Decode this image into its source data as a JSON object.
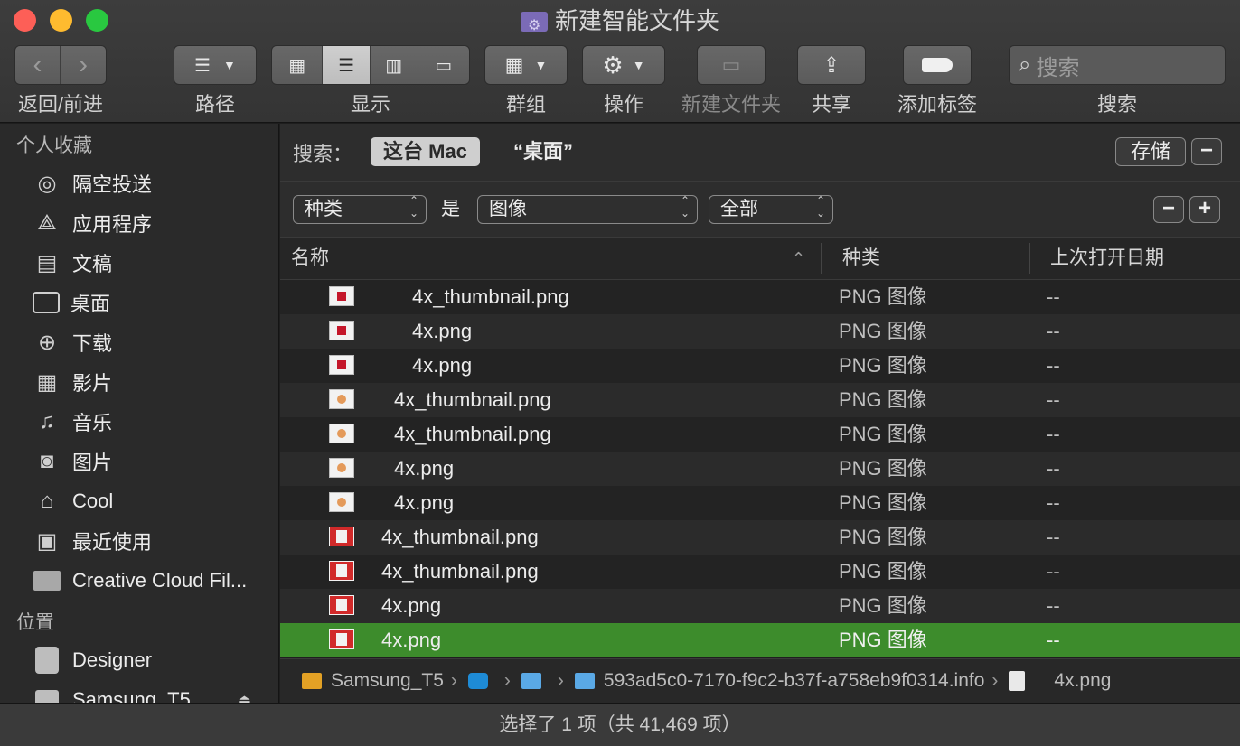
{
  "window": {
    "title": "新建智能文件夹"
  },
  "toolbar": {
    "nav_label": "返回/前进",
    "path_label": "路径",
    "view_label": "显示",
    "group_label": "群组",
    "action_label": "操作",
    "new_folder_label": "新建文件夹",
    "share_label": "共享",
    "tag_label": "添加标签",
    "search_label": "搜索",
    "search_placeholder": "搜索"
  },
  "sidebar": {
    "favorites_header": "个人收藏",
    "favorites": [
      {
        "label": "隔空投送",
        "icon": "airdrop-icon"
      },
      {
        "label": "应用程序",
        "icon": "applications-icon"
      },
      {
        "label": "文稿",
        "icon": "documents-icon"
      },
      {
        "label": "桌面",
        "icon": "desktop-icon"
      },
      {
        "label": "下载",
        "icon": "downloads-icon"
      },
      {
        "label": "影片",
        "icon": "movies-icon"
      },
      {
        "label": "音乐",
        "icon": "music-icon"
      },
      {
        "label": "图片",
        "icon": "pictures-icon"
      },
      {
        "label": "Cool",
        "icon": "home-icon"
      },
      {
        "label": "最近使用",
        "icon": "recents-icon"
      },
      {
        "label": "Creative Cloud Fil...",
        "icon": "folder-icon"
      }
    ],
    "locations_header": "位置",
    "locations": [
      {
        "label": "Designer",
        "icon": "disk-icon"
      },
      {
        "label": "Samsung_T5",
        "icon": "external-drive-icon"
      }
    ]
  },
  "search_scope": {
    "label": "搜索：",
    "this_mac": "这台 Mac",
    "desktop": "“桌面”",
    "save": "存储",
    "minus": "−"
  },
  "criteria": {
    "attribute": "种类",
    "is": "是",
    "value": "图像",
    "subvalue": "全部",
    "minus": "−",
    "plus": "+"
  },
  "columns": {
    "name": "名称",
    "kind": "种类",
    "last_opened": "上次打开日期"
  },
  "files": [
    {
      "name": "4x_thumbnail.png",
      "kind": "PNG 图像",
      "date": "--",
      "icon": "red-block"
    },
    {
      "name": "4x.png",
      "kind": "PNG 图像",
      "date": "--",
      "icon": "red-block"
    },
    {
      "name": "4x.png",
      "kind": "PNG 图像",
      "date": "--",
      "icon": "red-block"
    },
    {
      "name": "4x_thumbnail.png",
      "kind": "PNG 图像",
      "date": "--",
      "icon": "flower"
    },
    {
      "name": "4x_thumbnail.png",
      "kind": "PNG 图像",
      "date": "--",
      "icon": "flower"
    },
    {
      "name": "4x.png",
      "kind": "PNG 图像",
      "date": "--",
      "icon": "flower"
    },
    {
      "name": "4x.png",
      "kind": "PNG 图像",
      "date": "--",
      "icon": "flower"
    },
    {
      "name": "4x_thumbnail.png",
      "kind": "PNG 图像",
      "date": "--",
      "icon": "red-box"
    },
    {
      "name": "4x_thumbnail.png",
      "kind": "PNG 图像",
      "date": "--",
      "icon": "red-box"
    },
    {
      "name": "4x.png",
      "kind": "PNG 图像",
      "date": "--",
      "icon": "red-box"
    },
    {
      "name": "4x.png",
      "kind": "PNG 图像",
      "date": "--",
      "icon": "red-box",
      "selected": true
    }
  ],
  "pathbar": {
    "drive": "Samsung_T5",
    "folder": "593ad5c0-7170-f9c2-b37f-a758eb9f0314.info",
    "file": "4x.png"
  },
  "status": "选择了 1 项（共 41,469 项）",
  "colors": {
    "selection": "#3d8c2c",
    "accent": "#cfcfcf"
  }
}
